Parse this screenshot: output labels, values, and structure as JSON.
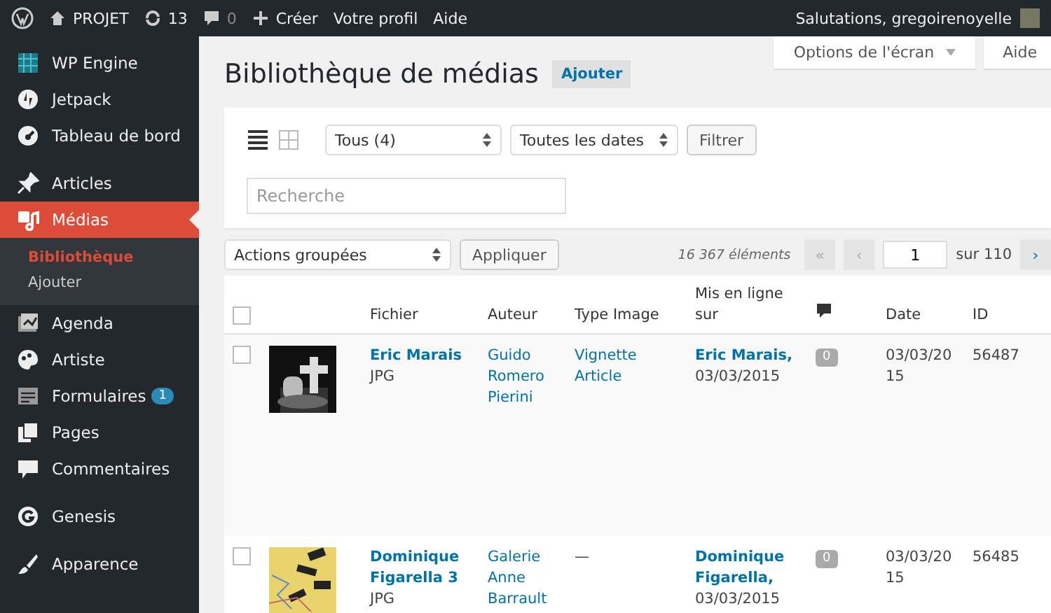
{
  "admin_bar": {
    "site": "PROJET",
    "updates": "13",
    "comments": "0",
    "create": "Créer",
    "profile": "Votre profil",
    "help": "Aide",
    "greeting": "Salutations, gregoirenoyelle"
  },
  "sidebar": {
    "items": [
      {
        "label": "WP Engine",
        "selected": false,
        "gap": false
      },
      {
        "label": "Jetpack",
        "selected": false,
        "gap": false
      },
      {
        "label": "Tableau de bord",
        "selected": false,
        "gap": false
      },
      {
        "label": "Articles",
        "selected": false,
        "gap": true
      },
      {
        "label": "Médias",
        "selected": true,
        "gap": false,
        "children": [
          {
            "label": "Bibliothèque",
            "selected": true
          },
          {
            "label": "Ajouter",
            "selected": false
          }
        ]
      },
      {
        "label": "Agenda",
        "selected": false,
        "gap": false
      },
      {
        "label": "Artiste",
        "selected": false,
        "gap": false
      },
      {
        "label": "Formulaires",
        "selected": false,
        "gap": false,
        "badge": "1"
      },
      {
        "label": "Pages",
        "selected": false,
        "gap": false
      },
      {
        "label": "Commentaires",
        "selected": false,
        "gap": false
      },
      {
        "label": "Genesis",
        "selected": false,
        "gap": true
      },
      {
        "label": "Apparence",
        "selected": false,
        "gap": true
      }
    ]
  },
  "screen_options": "Options de l'écran",
  "help_tab": "Aide",
  "title": "Bibliothèque de médias",
  "add_button": "Ajouter",
  "filters": {
    "view": [
      {
        "kind": "list",
        "selected": true
      },
      {
        "kind": "grid",
        "selected": false
      }
    ],
    "type_select": "Tous (4)",
    "date_select": "Toutes les dates",
    "filter_button": "Filtrer",
    "search": {
      "placeholder": "Recherche"
    }
  },
  "bulk": {
    "select": "Actions groupées",
    "apply": "Appliquer",
    "count": "16 367 éléments",
    "first": "«",
    "prev": "‹",
    "page": "1",
    "of": "sur 110",
    "next": "›"
  },
  "table": {
    "select_all_checked": false,
    "columns": [
      "Fichier",
      "Auteur",
      "Type Image",
      "Mis en ligne sur",
      "",
      "Date",
      "ID"
    ],
    "rows": [
      {
        "checked": false,
        "file": "Eric Marais",
        "ext": "JPG",
        "author": "Guido Romero Pierini",
        "type": "Vignette Article",
        "type_link": true,
        "uploaded_to": "Eric Marais,",
        "uploaded_date": "03/03/2015",
        "comments": "0",
        "date": "03/03/20 15",
        "id": "56487"
      },
      {
        "checked": false,
        "file": "Dominique Figarella 3",
        "ext": "JPG",
        "author": "Galerie Anne Barrault",
        "type": "—",
        "type_link": false,
        "uploaded_to": "Dominique Figarella,",
        "uploaded_date": "03/03/2015",
        "comments": "0",
        "date": "03/03/20 15",
        "id": "56485"
      }
    ]
  }
}
